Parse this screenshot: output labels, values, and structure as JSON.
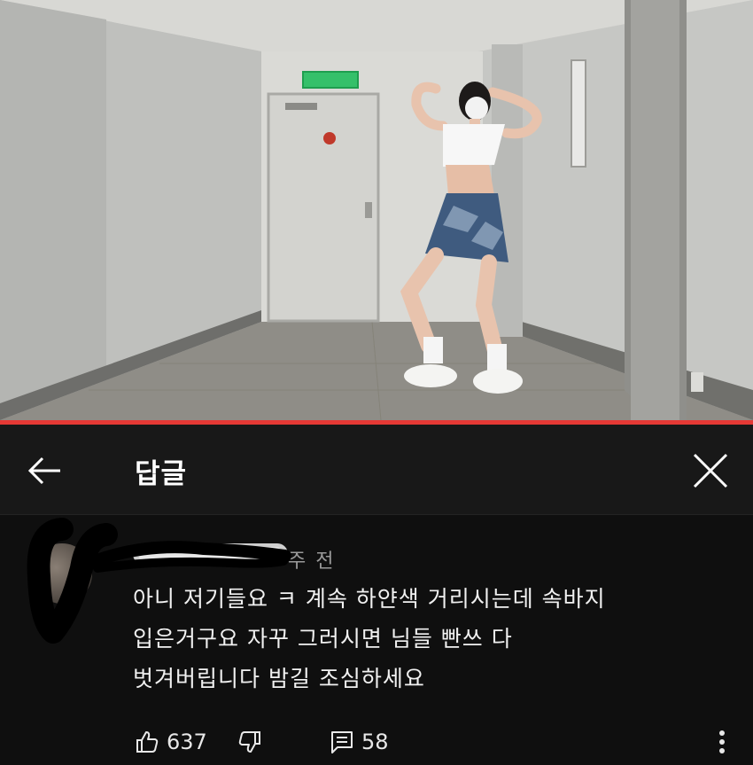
{
  "header": {
    "title": "답글"
  },
  "video": {
    "progress_fraction": 1.0
  },
  "comment": {
    "time": "주 전",
    "text_lines": [
      "아니 저기들요 ㅋ 계속 하얀색 거리시는데 속바지",
      "입은거구요 자꾸 그러시면 님들 빤쓰 다",
      "벗겨버립니다 밤길 조심하세요"
    ],
    "likes": "637",
    "replies": "58"
  },
  "icons": {
    "back": "arrow-left-icon",
    "close": "close-icon",
    "like": "thumbs-up-icon",
    "dislike": "thumbs-down-icon",
    "reply": "comment-icon",
    "more": "more-vertical-icon"
  },
  "colors": {
    "accent": "#e53935",
    "background": "#0f0f0f",
    "header_bg": "#181818",
    "muted_text": "#9a9a9a"
  }
}
